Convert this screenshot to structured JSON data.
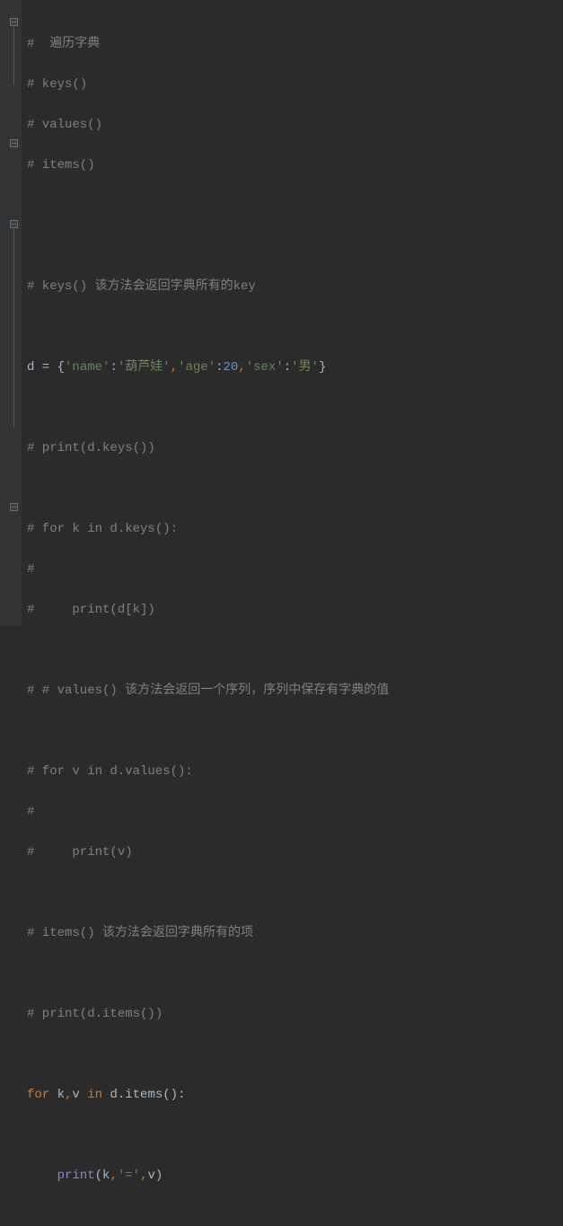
{
  "code": {
    "l1": "#  遍历字典",
    "l2": "# keys()",
    "l3": "# values()",
    "l4": "# items()",
    "l5": "",
    "l6": "",
    "l7": "# keys() 该方法会返回字典所有的key",
    "l8": "",
    "l9_d": "d",
    "l9_eq": " = ",
    "l9_ob": "{",
    "l9_k1": "'name'",
    "l9_c1": ":",
    "l9_v1": "'葫芦娃'",
    "l9_cm1": ",",
    "l9_k2": "'age'",
    "l9_c2": ":",
    "l9_v2": "20",
    "l9_cm2": ",",
    "l9_k3": "'sex'",
    "l9_c3": ":",
    "l9_v3": "'男'",
    "l9_cb": "}",
    "l10": "",
    "l11": "# print(d.keys())",
    "l12": "",
    "l13": "# for k in d.keys():",
    "l14": "#",
    "l15": "#     print(d[k])",
    "l16": "",
    "l17": "# # values() 该方法会返回一个序列，序列中保存有字典的值",
    "l18": "",
    "l19": "# for v in d.values():",
    "l20": "#",
    "l21": "#     print(v)",
    "l22": "",
    "l23": "# items() 该方法会返回字典所有的项",
    "l24": "",
    "l25": "# print(d.items())",
    "l26": "",
    "l27_for": "for ",
    "l27_k": "k",
    "l27_cm": ",",
    "l27_v": "v",
    "l27_in": " in ",
    "l27_d": "d.items()",
    "l27_colon": ":",
    "l28": "",
    "l29_indent": "    ",
    "l29_print": "print",
    "l29_op": "(",
    "l29_k": "k",
    "l29_cm1": ",",
    "l29_eq": "'='",
    "l29_cm2": ",",
    "l29_v": "v",
    "l29_cp": ")"
  }
}
